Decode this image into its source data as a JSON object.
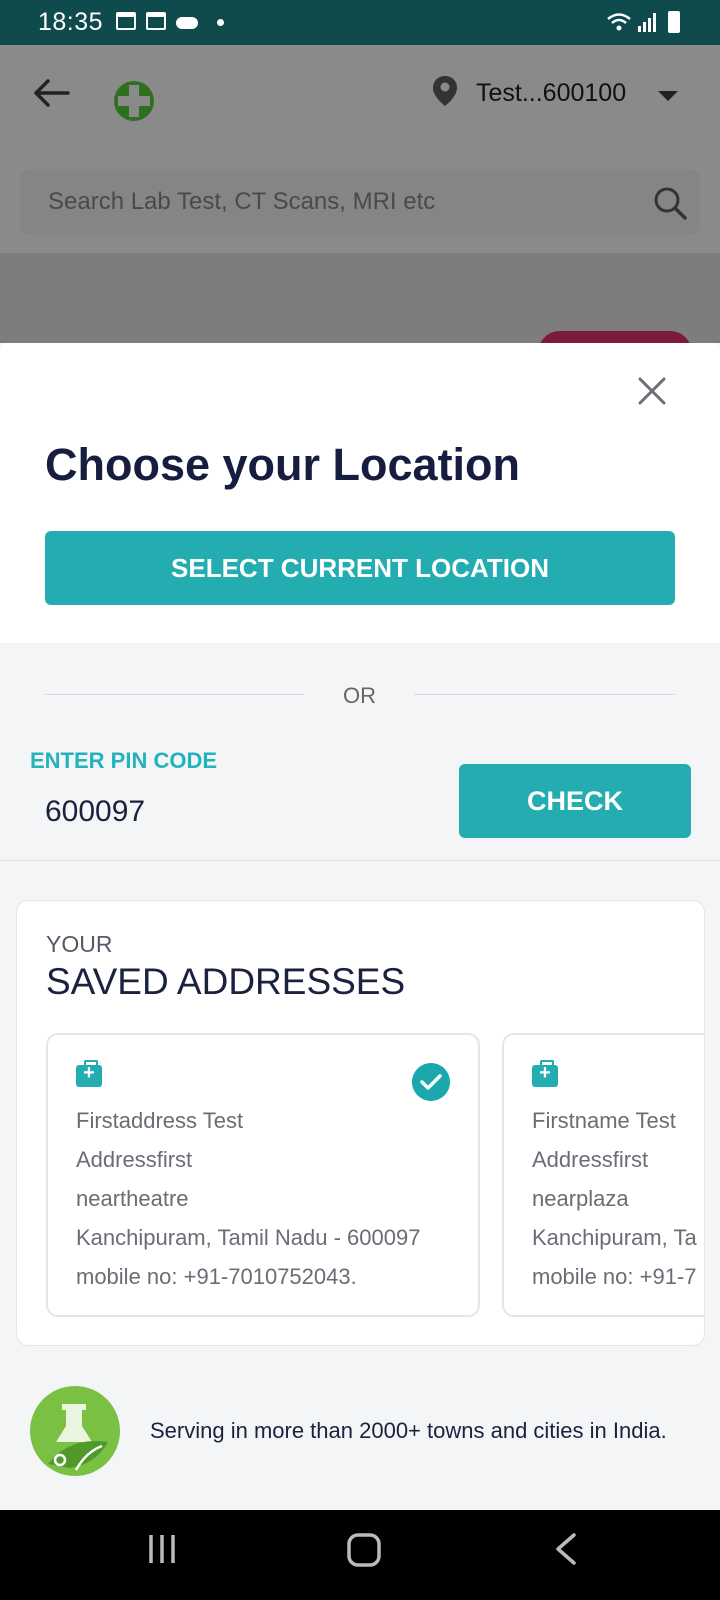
{
  "status_bar": {
    "time": "18:35"
  },
  "header": {
    "location_label": "Test...600100",
    "search_placeholder": "Search Lab Test, CT Scans, MRI etc"
  },
  "modal": {
    "title": "Choose your Location",
    "select_current_label": "SELECT CURRENT LOCATION",
    "or_label": "OR",
    "pin_label": "ENTER PIN CODE",
    "pin_value": "600097",
    "check_label": "CHECK"
  },
  "saved_addresses": {
    "label_small": "YOUR",
    "label_large": "SAVED ADDRESSES",
    "items": [
      {
        "line1": "Firstaddress Test",
        "line2": "Addressfirst",
        "line3": "neartheatre",
        "line4": "Kanchipuram,  Tamil Nadu - 600097",
        "line5": "mobile no: +91-7010752043.",
        "selected": true
      },
      {
        "line1": "Firstname Test",
        "line2": "Addressfirst",
        "line3": "nearplaza",
        "line4": "Kanchipuram,  Ta",
        "line5": "mobile no: +91-7",
        "selected": false
      }
    ]
  },
  "footer": {
    "serving_text": "Serving in more than 2000+ towns and cities in India."
  },
  "colors": {
    "accent": "#24adb0",
    "status_bar": "#0f4a4c",
    "title": "#161d3f",
    "brand_green": "#7ac143"
  },
  "icons": [
    "back-arrow-icon",
    "location-pin-icon",
    "search-icon",
    "close-icon",
    "first-aid-kit-icon",
    "check-circle-icon",
    "lab-flask-icon"
  ]
}
